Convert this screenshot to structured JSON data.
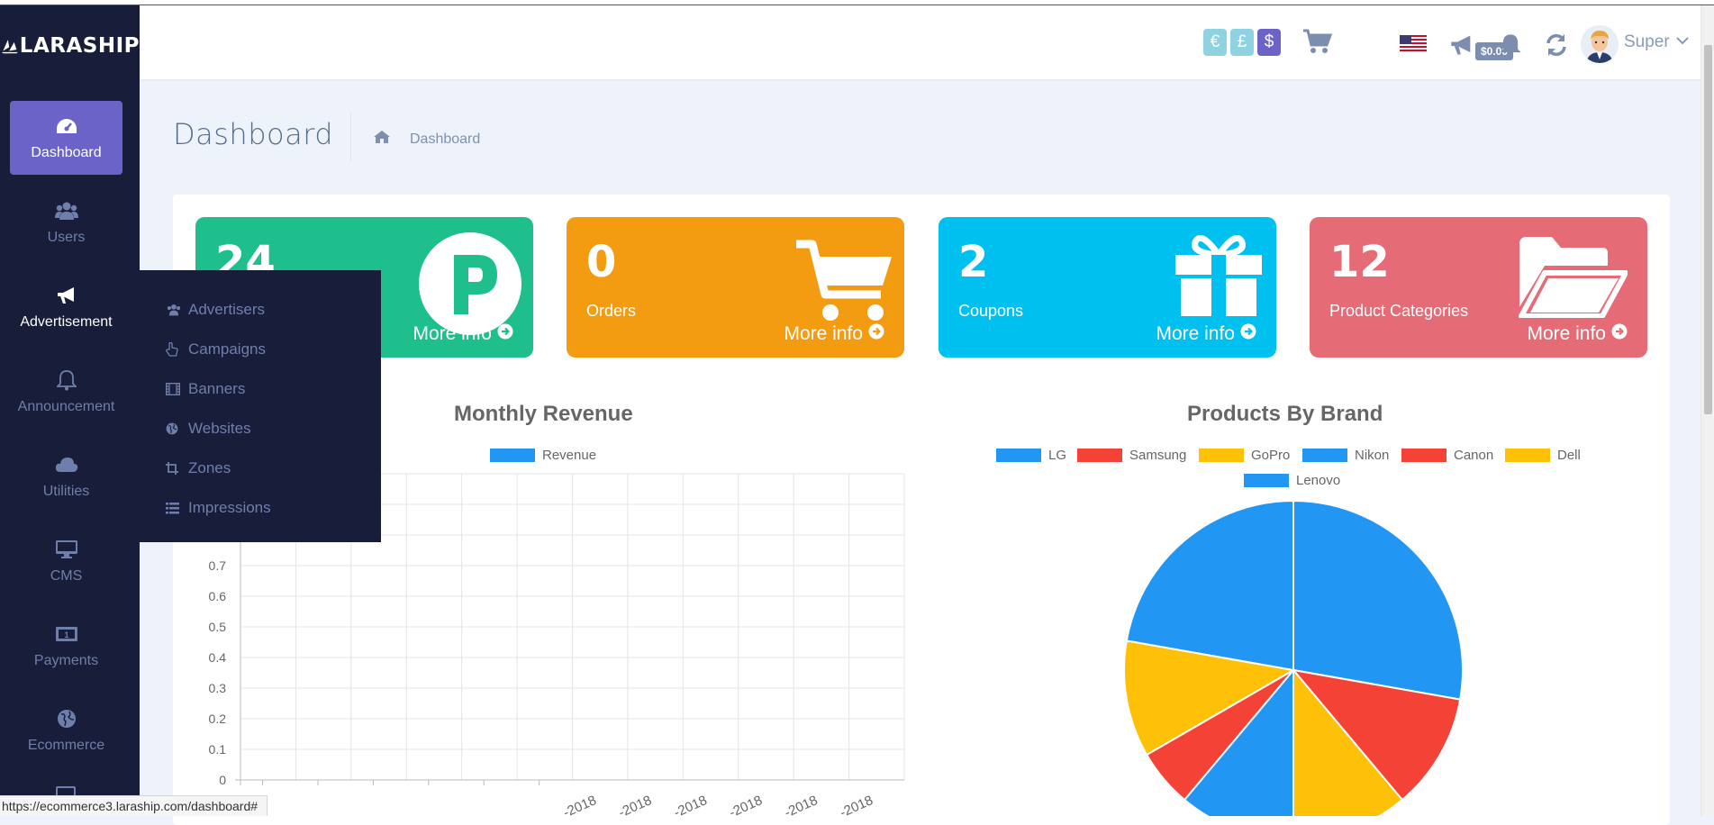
{
  "brand": {
    "name": "LARASHIP"
  },
  "sidebar": {
    "items": [
      {
        "label": "Dashboard",
        "icon": "dashboard-icon",
        "active": true
      },
      {
        "label": "Users",
        "icon": "users-icon"
      },
      {
        "label": "Advertisement",
        "icon": "bullhorn-icon"
      },
      {
        "label": "Announcement",
        "icon": "bell-icon"
      },
      {
        "label": "Utilities",
        "icon": "cloud-icon"
      },
      {
        "label": "CMS",
        "icon": "desktop-icon"
      },
      {
        "label": "Payments",
        "icon": "money-icon"
      },
      {
        "label": "Ecommerce",
        "icon": "globe-icon"
      }
    ]
  },
  "flyout": {
    "items": [
      {
        "label": "Advertisers",
        "icon": "users-icon"
      },
      {
        "label": "Campaigns",
        "icon": "hand-pointer-icon"
      },
      {
        "label": "Banners",
        "icon": "film-icon"
      },
      {
        "label": "Websites",
        "icon": "globe-icon"
      },
      {
        "label": "Zones",
        "icon": "crop-icon"
      },
      {
        "label": "Impressions",
        "icon": "list-icon"
      }
    ]
  },
  "header": {
    "currencies": [
      {
        "symbol": "€",
        "color": "#8fd3e3"
      },
      {
        "symbol": "£",
        "color": "#8fd3e3"
      },
      {
        "symbol": "$",
        "color": "#6c63c9"
      }
    ],
    "cart_total": "$0.00",
    "user_name": "Super"
  },
  "page": {
    "title": "Dashboard",
    "breadcrumb": "Dashboard"
  },
  "cards": [
    {
      "value": "24",
      "label": "",
      "more": "More info",
      "color": "#1fbe8d",
      "icon": "product-hunt-icon"
    },
    {
      "value": "0",
      "label": "Orders",
      "more": "More info",
      "color": "#f39c12",
      "icon": "shopping-cart-icon"
    },
    {
      "value": "2",
      "label": "Coupons",
      "more": "More info",
      "color": "#00c0ef",
      "icon": "gift-icon"
    },
    {
      "value": "12",
      "label": "Product Categories",
      "more": "More info",
      "color": "#e56b76",
      "icon": "folder-open-icon"
    }
  ],
  "chart_data": [
    {
      "type": "line",
      "title": "Monthly Revenue",
      "series": [
        {
          "name": "Revenue",
          "values": []
        }
      ],
      "y_ticks": [
        "0.7",
        "0.6",
        "0.5",
        "0.4",
        "0.3",
        "0.2",
        "0.1",
        "0"
      ],
      "x_tick_labels_visible": [
        "-2018",
        "-2018",
        "-2018",
        "-2018",
        "-2018",
        "-2018"
      ],
      "ylim": [
        0,
        1
      ],
      "grid": true,
      "legend": "top",
      "color": "#2196f3"
    },
    {
      "type": "pie",
      "title": "Products By Brand",
      "labels": [
        "LG",
        "Samsung",
        "GoPro",
        "Nikon",
        "Canon",
        "Dell",
        "Lenovo"
      ],
      "values": [
        5,
        2,
        2,
        2,
        1,
        2,
        4
      ],
      "colors": [
        "#2196f3",
        "#f44336",
        "#ffc107",
        "#2196f3",
        "#f44336",
        "#ffc107",
        "#2196f3"
      ],
      "legend": "top"
    }
  ],
  "status_url": "https://ecommerce3.laraship.com/dashboard#"
}
